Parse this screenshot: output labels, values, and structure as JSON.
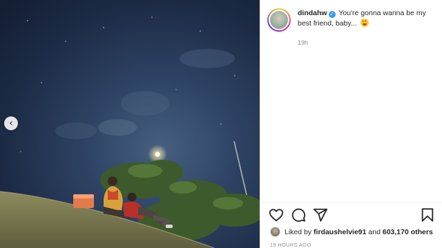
{
  "post": {
    "username": "dindahw",
    "caption_text": "You're gonna wanna be my best friend, baby...",
    "emoji_icon": "savoring-food-emoji",
    "relative_time": "19h",
    "time_ago": "19 HOURS AGO"
  },
  "likes": {
    "prefix": "Liked by",
    "liker": "firdaushelvie91",
    "conjunction": "and",
    "count_text": "603,170 others"
  },
  "icons": {
    "prev": "chevron-left-icon",
    "like": "heart-icon",
    "comment": "comment-icon",
    "share": "share-icon",
    "save": "bookmark-icon",
    "verified": "verified-badge-icon"
  },
  "colors": {
    "sky_top": "#131d33",
    "sky_mid": "#2d4262",
    "verified": "#3897f0",
    "text": "#262626",
    "muted": "#8e8e8e"
  }
}
